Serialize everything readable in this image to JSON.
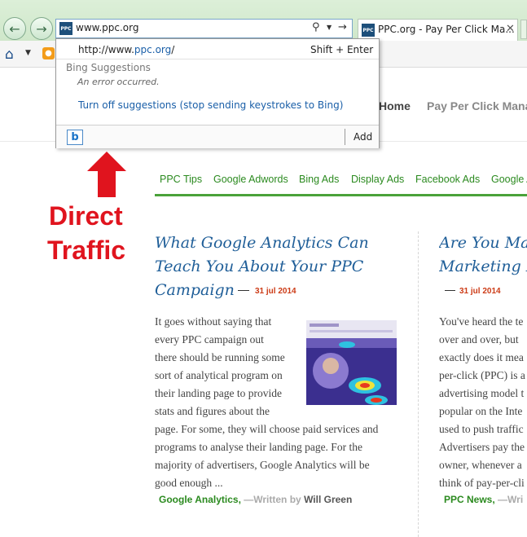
{
  "browser": {
    "address_value": "www.ppc.org",
    "tab_title": "PPC.org - Pay Per Click Ma...",
    "favicon_text": "PPC",
    "dropdown": {
      "url_prefix": "http://www.",
      "url_domain": "ppc.org",
      "url_suffix": "/",
      "shortcut": "Shift + Enter",
      "suggestions_heading": "Bing Suggestions",
      "error_text": "An error occurred.",
      "turn_off_link": "Turn off suggestions (stop sending keystrokes to Bing)",
      "bing_logo_letter": "b",
      "add_label": "Add"
    }
  },
  "site": {
    "nav": [
      "Home",
      "Pay Per Click Mana"
    ],
    "categories": [
      "PPC Tips",
      "Google Adwords",
      "Bing Ads",
      "Display Ads",
      "Facebook Ads",
      "Google A"
    ],
    "posts": [
      {
        "title_lines": [
          "What Google Analytics Can",
          "Teach You About Your PPC",
          "Campaign"
        ],
        "date": "31 jul 2014",
        "body_narrow_lines": [
          "It goes without saying that",
          "every PPC campaign out",
          "there should be running some",
          "sort of analytical program on",
          "their landing page to provide",
          "stats and figures about the"
        ],
        "body_wide_lines": [
          "page. For some, they will choose paid services and",
          "programs to analyse their landing page. For the",
          "majority of advertisers, Google Analytics will be",
          "good enough ..."
        ],
        "tag": "Google Analytics,",
        "written_by": "—Written by",
        "author": "Will Green"
      },
      {
        "title_lines": [
          "Are You Ma",
          "Marketing B"
        ],
        "date": "31 jul 2014",
        "body_lines": [
          "You've heard the te",
          "over and over, but",
          "exactly does it mea",
          "per-click (PPC) is a",
          "advertising model t",
          "popular on the Inte",
          "used to push traffic",
          "Advertisers pay the",
          "owner, whenever a",
          "think of pay-per-cli"
        ],
        "tag": "PPC News,",
        "written_by": "—Wri"
      }
    ]
  },
  "annotation": {
    "line1": "Direct",
    "line2": "Traffic",
    "color": "#e0141e"
  },
  "colors": {
    "accent_green": "#2b8a1f",
    "title_blue": "#1f5e98",
    "date_orange": "#cc3b16"
  }
}
